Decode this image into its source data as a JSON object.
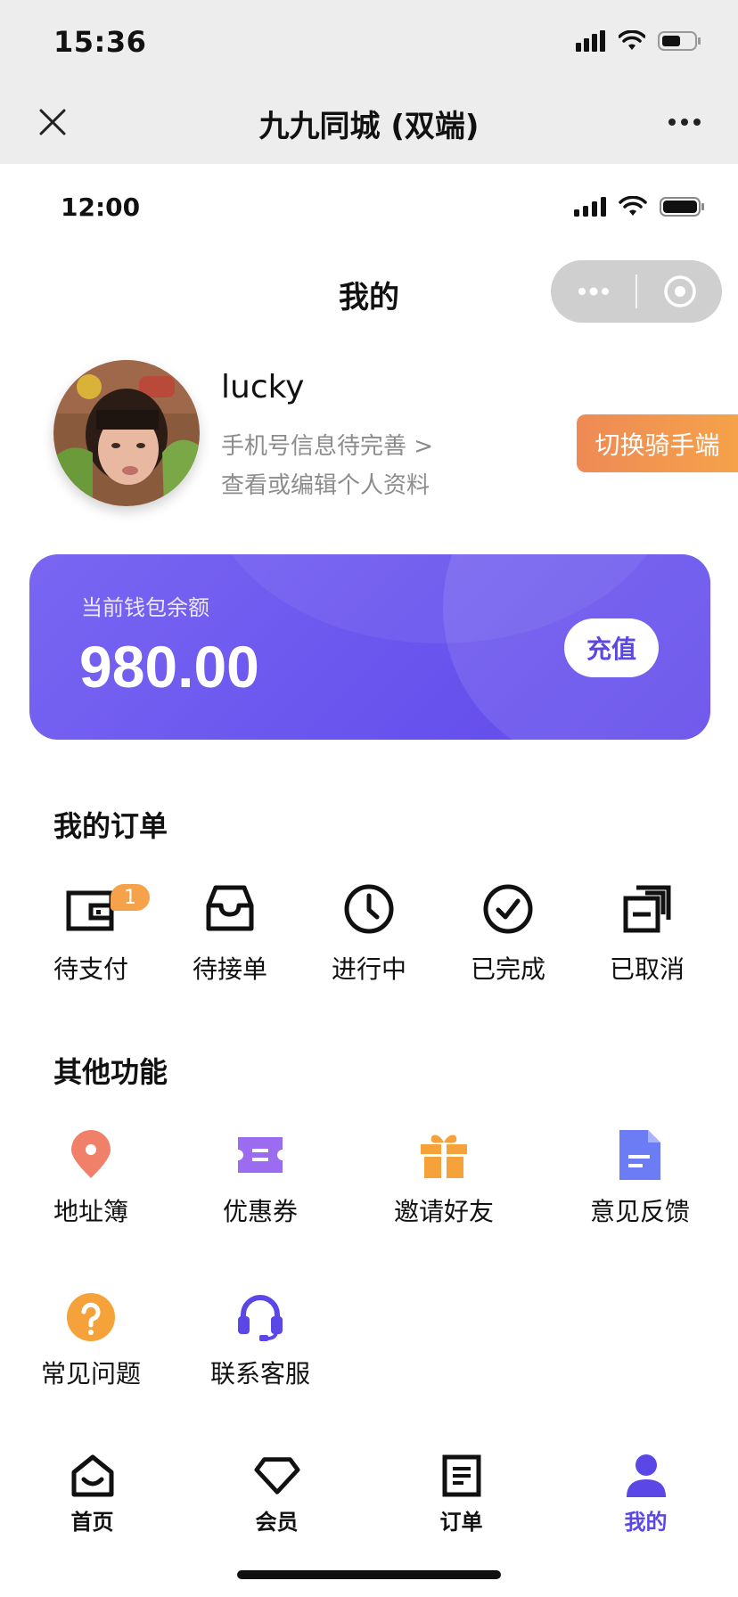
{
  "outer": {
    "time": "15:36",
    "wechat_title": "九九同城 (双端)"
  },
  "inner": {
    "time": "12:00",
    "page_title": "我的"
  },
  "profile": {
    "username": "lucky",
    "phone_hint": "手机号信息待完善 >",
    "edit_hint": "查看或编辑个人资料",
    "switch_label": "切换骑手端"
  },
  "wallet": {
    "label": "当前钱包余额",
    "amount": "980.00",
    "recharge_label": "充值"
  },
  "orders": {
    "title": "我的订单",
    "badge": "1",
    "items": [
      {
        "label": "待支付",
        "icon": "wallet-icon"
      },
      {
        "label": "待接单",
        "icon": "inbox-icon"
      },
      {
        "label": "进行中",
        "icon": "clock-icon"
      },
      {
        "label": "已完成",
        "icon": "check-circle-icon"
      },
      {
        "label": "已取消",
        "icon": "cancelled-docs-icon"
      }
    ]
  },
  "functions": {
    "title": "其他功能",
    "items": [
      {
        "label": "地址簿",
        "icon": "location-pin-icon"
      },
      {
        "label": "优惠券",
        "icon": "coupon-icon"
      },
      {
        "label": "邀请好友",
        "icon": "gift-icon"
      },
      {
        "label": "意见反馈",
        "icon": "document-icon"
      },
      {
        "label": "常见问题",
        "icon": "question-icon"
      },
      {
        "label": "联系客服",
        "icon": "headset-icon"
      }
    ]
  },
  "tabbar": {
    "items": [
      {
        "label": "首页",
        "icon": "home-icon"
      },
      {
        "label": "会员",
        "icon": "diamond-icon"
      },
      {
        "label": "订单",
        "icon": "order-list-icon"
      },
      {
        "label": "我的",
        "icon": "user-icon",
        "active": true
      }
    ]
  },
  "colors": {
    "accent": "#5b46e6",
    "wallet_gradient_start": "#7a66f2",
    "wallet_gradient_end": "#6148ea",
    "switch_orange": "#f09650",
    "pin_coral": "#f0806a",
    "coupon_purple": "#9b6cf0",
    "gift_orange": "#f5a23a",
    "feedback_blue": "#6b7cf5",
    "question_orange": "#f5a23a",
    "headset_indigo": "#5b46e6"
  }
}
